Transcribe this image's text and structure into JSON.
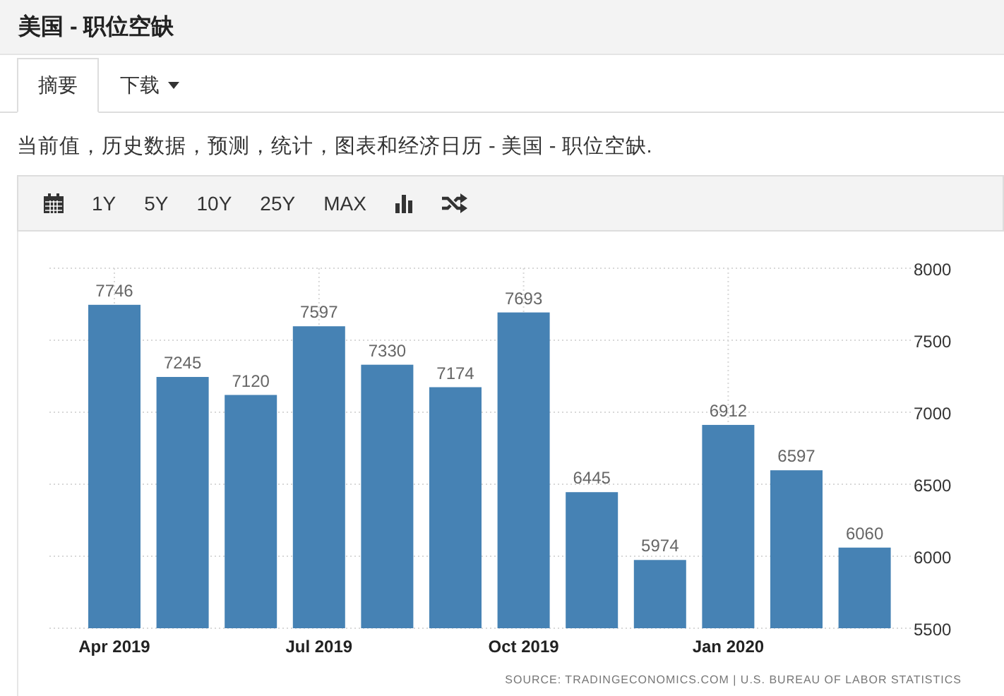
{
  "title": "美国 - 职位空缺",
  "tabs": [
    {
      "label": "摘要",
      "selected": true,
      "dropdown": false
    },
    {
      "label": "下载",
      "selected": false,
      "dropdown": true
    }
  ],
  "description": "当前值，历史数据，预测，统计，图表和经济日历 - 美国 - 职位空缺.",
  "toolbar": [
    {
      "kind": "calendar"
    },
    {
      "kind": "text",
      "label": "1Y"
    },
    {
      "kind": "text",
      "label": "5Y"
    },
    {
      "kind": "text",
      "label": "10Y"
    },
    {
      "kind": "text",
      "label": "25Y"
    },
    {
      "kind": "text",
      "label": "MAX"
    },
    {
      "kind": "barchart"
    },
    {
      "kind": "shuffle"
    }
  ],
  "chart": {
    "chart_data": {
      "type": "bar",
      "categories": [
        "Apr 2019",
        null,
        null,
        "Jul 2019",
        null,
        null,
        "Oct 2019",
        null,
        null,
        "Jan 2020",
        null,
        null
      ],
      "grid": true,
      "series": [
        {
          "color": "#4682b4",
          "values": [
            7746,
            7245,
            7120,
            7597,
            7330,
            7174,
            7693,
            6445,
            5974,
            6912,
            6597,
            6060
          ]
        }
      ],
      "ylim": [
        5500,
        8000
      ],
      "yticks": [
        5500,
        6000,
        6500,
        7000,
        7500,
        8000
      ],
      "data_labels": true
    },
    "source": "SOURCE: TRADINGECONOMICS.COM  |  U.S. BUREAU OF LABOR STATISTICS"
  }
}
